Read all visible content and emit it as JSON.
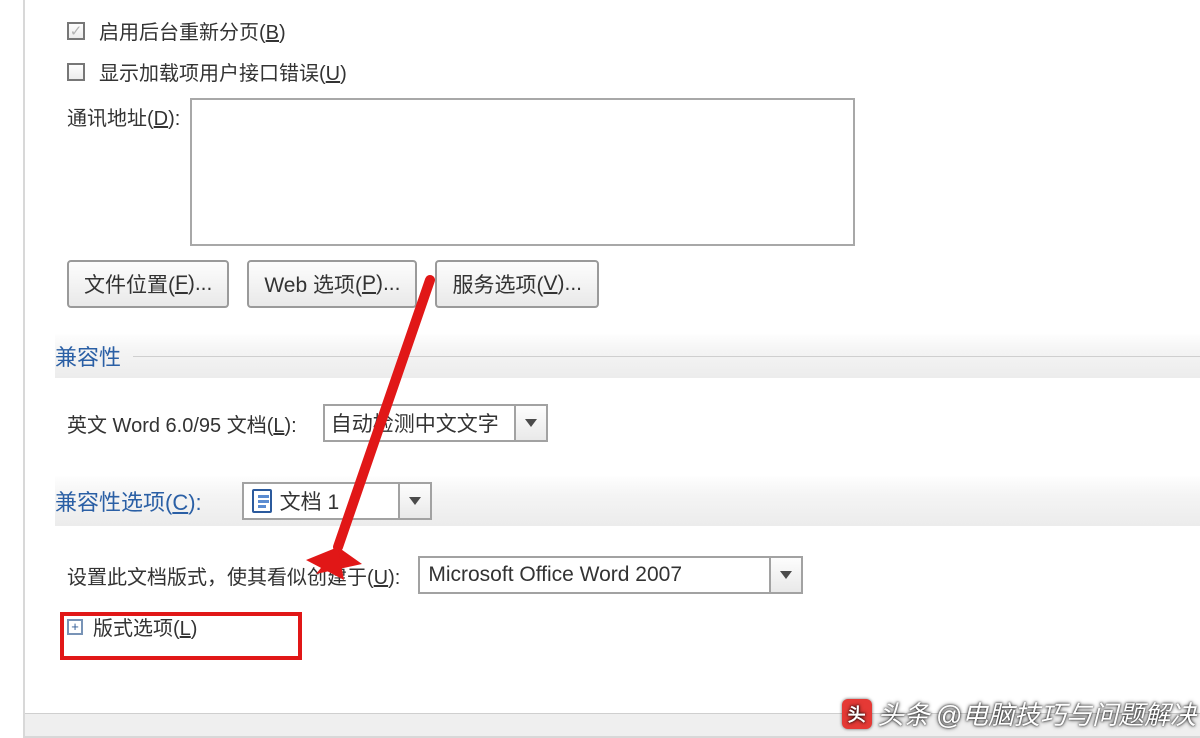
{
  "checks": {
    "enable_bg_repagination": {
      "label_pre": "启用后台重新分页(",
      "key": "B",
      "label_post": ")",
      "checked": true
    },
    "show_addin_errors": {
      "label_pre": "显示加载项用户接口错误(",
      "key": "U",
      "label_post": ")",
      "checked": false
    }
  },
  "address_row": {
    "label_pre": "通讯地址(",
    "key": "D",
    "label_post": "):",
    "value": ""
  },
  "buttons": {
    "file_locations": {
      "pre": "文件位置(",
      "key": "F",
      "post": ")..."
    },
    "web_options": {
      "pre": "Web 选项(",
      "key": "P",
      "post": ")..."
    },
    "service_options": {
      "pre": "服务选项(",
      "key": "V",
      "post": ")..."
    }
  },
  "section_compat": "兼容性",
  "word6095": {
    "label_pre": "英文 Word 6.0/95 文档(",
    "key": "L",
    "label_post": "):",
    "selected": "自动检测中文文字"
  },
  "section_compat_options": {
    "pre": "兼容性选项(",
    "key": "C",
    "post": "):"
  },
  "compat_doc_selected": "文档 1",
  "setformat": {
    "label_pre": "设置此文档版式，使其看似创建于(",
    "key": "U",
    "label_post": "):",
    "selected": "Microsoft Office Word 2007"
  },
  "layout_options": {
    "pre": "版式选项(",
    "key": "L",
    "post": ")"
  },
  "watermark": {
    "logo": "头",
    "prefix": "头条",
    "text": "@电脑技巧与问题解决"
  }
}
